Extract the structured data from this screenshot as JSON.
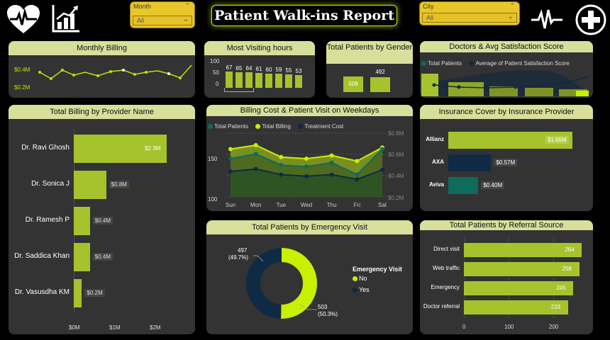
{
  "header": {
    "title": "Patient Walk-ins  Report",
    "month_slicer": {
      "label": "Month",
      "value": "All"
    },
    "city_slicer": {
      "label": "City",
      "value": "All"
    },
    "icons": [
      "heart-pulse-icon",
      "bar-chart-icon",
      "pulse-line-icon",
      "plus-circle-icon"
    ]
  },
  "colors": {
    "lime": "#a6c32e",
    "bright_lime": "#c8f000",
    "navy": "#0f2a44",
    "teal": "#0f6b5c",
    "title_bar": "#d8df9b",
    "card": "#333333"
  },
  "monthly_billing": {
    "title": "Monthly Billing",
    "y_ticks": [
      "$0.4M",
      "$0.2M"
    ]
  },
  "visiting_hours": {
    "title": "Most Visiting hours",
    "y_ticks": [
      "100",
      "50",
      "0"
    ],
    "chart_data": {
      "type": "bar",
      "values": [
        67,
        65,
        64,
        61,
        60,
        59,
        55,
        53
      ],
      "ylim": [
        0,
        100
      ]
    }
  },
  "gender": {
    "title": "Total Patients by Gender",
    "chart_data": {
      "type": "bar",
      "values": [
        508,
        492
      ]
    }
  },
  "doctors_satisfaction": {
    "title": "Doctors & Avg Satisfaction Score",
    "legend": [
      "Total Patients",
      "Average of Patient Satisfaction Score"
    ]
  },
  "provider_billing": {
    "title": "Total Billing by Provider Name",
    "x_ticks": [
      "$0M",
      "$1M",
      "$2M"
    ],
    "chart_data": {
      "type": "bar",
      "categories": [
        "Dr. Ravi Ghosh",
        "Dr. Sonica J",
        "Dr. Ramesh P",
        "Dr. Saddica Khan",
        "Dr. Vasusdha KM"
      ],
      "values": [
        2.3,
        0.8,
        0.4,
        0.4,
        0.2
      ],
      "labels": [
        "$2.3M",
        "$0.8M",
        "$0.4M",
        "$0.4M",
        "$0.2M"
      ],
      "xlim": [
        0,
        2.4
      ]
    }
  },
  "weekday": {
    "title": "Billing Cost & Patient Visit on Weekdays",
    "legend": [
      "Total Patients",
      "Total Billing",
      "Treatment Cost"
    ],
    "y_left_ticks": [
      "150",
      "100"
    ],
    "y_right_ticks": [
      "$0.8M",
      "$0.6M",
      "$0.4M",
      "$0.2M"
    ],
    "chart_data": {
      "type": "area",
      "categories": [
        "Sun",
        "Mon",
        "Tue",
        "Wed",
        "Thu",
        "Fri",
        "Sat"
      ],
      "series": [
        {
          "name": "Total Patients",
          "values": [
            148,
            154,
            140,
            138,
            143,
            128,
            160
          ]
        },
        {
          "name": "Total Billing",
          "values": [
            160,
            165,
            150,
            148,
            152,
            145,
            162
          ]
        },
        {
          "name": "Treatment Cost",
          "values": [
            132,
            135,
            128,
            126,
            128,
            122,
            134
          ]
        }
      ],
      "ylim": [
        100,
        180
      ]
    }
  },
  "insurance": {
    "title": "Insurance Cover by Insurance Provider",
    "chart_data": {
      "type": "bar",
      "categories": [
        "Allianz",
        "AXA",
        "Aviva"
      ],
      "values": [
        1.65,
        0.57,
        0.4
      ],
      "labels": [
        "$1.65M",
        "$0.57M",
        "$0.40M"
      ]
    }
  },
  "emergency": {
    "title": "Total Patients by Emergency Visit",
    "legend_title": "Emergency Visit",
    "chart_data": {
      "type": "pie",
      "categories": [
        "No",
        "Yes"
      ],
      "values": [
        503,
        497
      ],
      "labels_value": [
        "503",
        "497"
      ],
      "labels_pct": [
        "(50.3%)",
        "(49.7%)"
      ]
    }
  },
  "referral": {
    "title": "Total Patients by Referral Source",
    "x_ticks": [
      "0",
      "100",
      "200"
    ],
    "chart_data": {
      "type": "bar",
      "categories": [
        "Direct visit",
        "Web traffic",
        "Emergency",
        "Doctor referral"
      ],
      "values": [
        264,
        258,
        245,
        233
      ],
      "labels": [
        "264",
        "258",
        "245",
        "233"
      ],
      "xlim": [
        0,
        280
      ]
    }
  }
}
